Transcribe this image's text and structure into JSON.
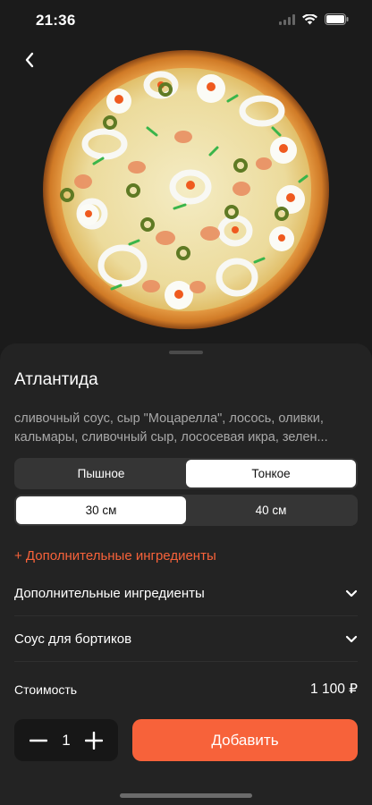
{
  "status": {
    "time": "21:36"
  },
  "product": {
    "name": "Атлантида",
    "description": "сливочный соус, сыр \"Моцарелла\", лосось, оливки, кальмары, сливочный сыр, лососевая икра, зелен..."
  },
  "dough_options": {
    "selected": "Тонкое",
    "items": [
      "Пышное",
      "Тонкое"
    ]
  },
  "size_options": {
    "selected": "30 см",
    "items": [
      "30 см",
      "40 см"
    ]
  },
  "extras_link": "+ Дополнительные ингредиенты",
  "accordions": [
    {
      "label": "Дополнительные ингредиенты"
    },
    {
      "label": "Соус для бортиков"
    }
  ],
  "price": {
    "label": "Стоимость",
    "value": "1 100 ₽"
  },
  "quantity": "1",
  "add_button": "Добавить",
  "colors": {
    "accent": "#f7623a",
    "sheet": "#232323",
    "background": "#1a1a1a"
  }
}
